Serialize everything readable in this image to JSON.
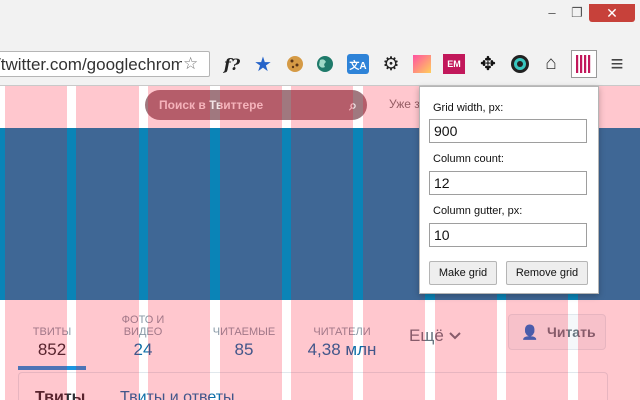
{
  "browser": {
    "minimize": "–",
    "restore": "❐",
    "close": "✕",
    "url": "/twitter.com/googlechrome",
    "star": "☆",
    "extensions": [
      {
        "name": "font-finder-icon",
        "glyph": "f?"
      },
      {
        "name": "bookmark-star-icon",
        "glyph": "★"
      },
      {
        "name": "cookie-icon",
        "glyph": "🍪"
      },
      {
        "name": "globe-icon",
        "glyph": "🌏"
      },
      {
        "name": "translate-icon",
        "glyph": "文A"
      },
      {
        "name": "gear-icon",
        "glyph": "⚙"
      },
      {
        "name": "gradient-icon",
        "glyph": ""
      },
      {
        "name": "em-icon",
        "glyph": "EM"
      },
      {
        "name": "move-tool-icon",
        "glyph": "✥"
      },
      {
        "name": "color-wheel-icon",
        "glyph": "◉"
      },
      {
        "name": "home-icon",
        "glyph": "⌂"
      },
      {
        "name": "grid-overlay-icon",
        "glyph": "||||"
      },
      {
        "name": "menu-icon",
        "glyph": "≡"
      }
    ]
  },
  "twitter": {
    "search_placeholder": "Поиск в Твиттере",
    "search_icon": "⌕",
    "already_text": "Уже з",
    "stats": [
      {
        "label": "ТВИТЫ",
        "value": "852"
      },
      {
        "label": "ФОТО И ВИДЕО",
        "value": "24"
      },
      {
        "label": "ЧИТАЕМЫЕ",
        "value": "85"
      },
      {
        "label": "ЧИТАТЕЛИ",
        "value": "4,38 млн"
      }
    ],
    "more_label": "Ещё",
    "follow_icon": "👤",
    "follow_label": "Читать",
    "tabs": [
      "Твиты",
      "Твиты и ответы"
    ]
  },
  "grid_tool": {
    "width_label": "Grid width, px:",
    "width_value": "900",
    "count_label": "Column count:",
    "count_value": "12",
    "gutter_label": "Column gutter, px:",
    "gutter_value": "10",
    "make_button": "Make grid",
    "remove_button": "Remove grid"
  },
  "colors": {
    "banner": "#0a84b7",
    "grid_overlay": "#ff001e",
    "link": "#0e6fa8",
    "close_button": "#c7413a"
  }
}
